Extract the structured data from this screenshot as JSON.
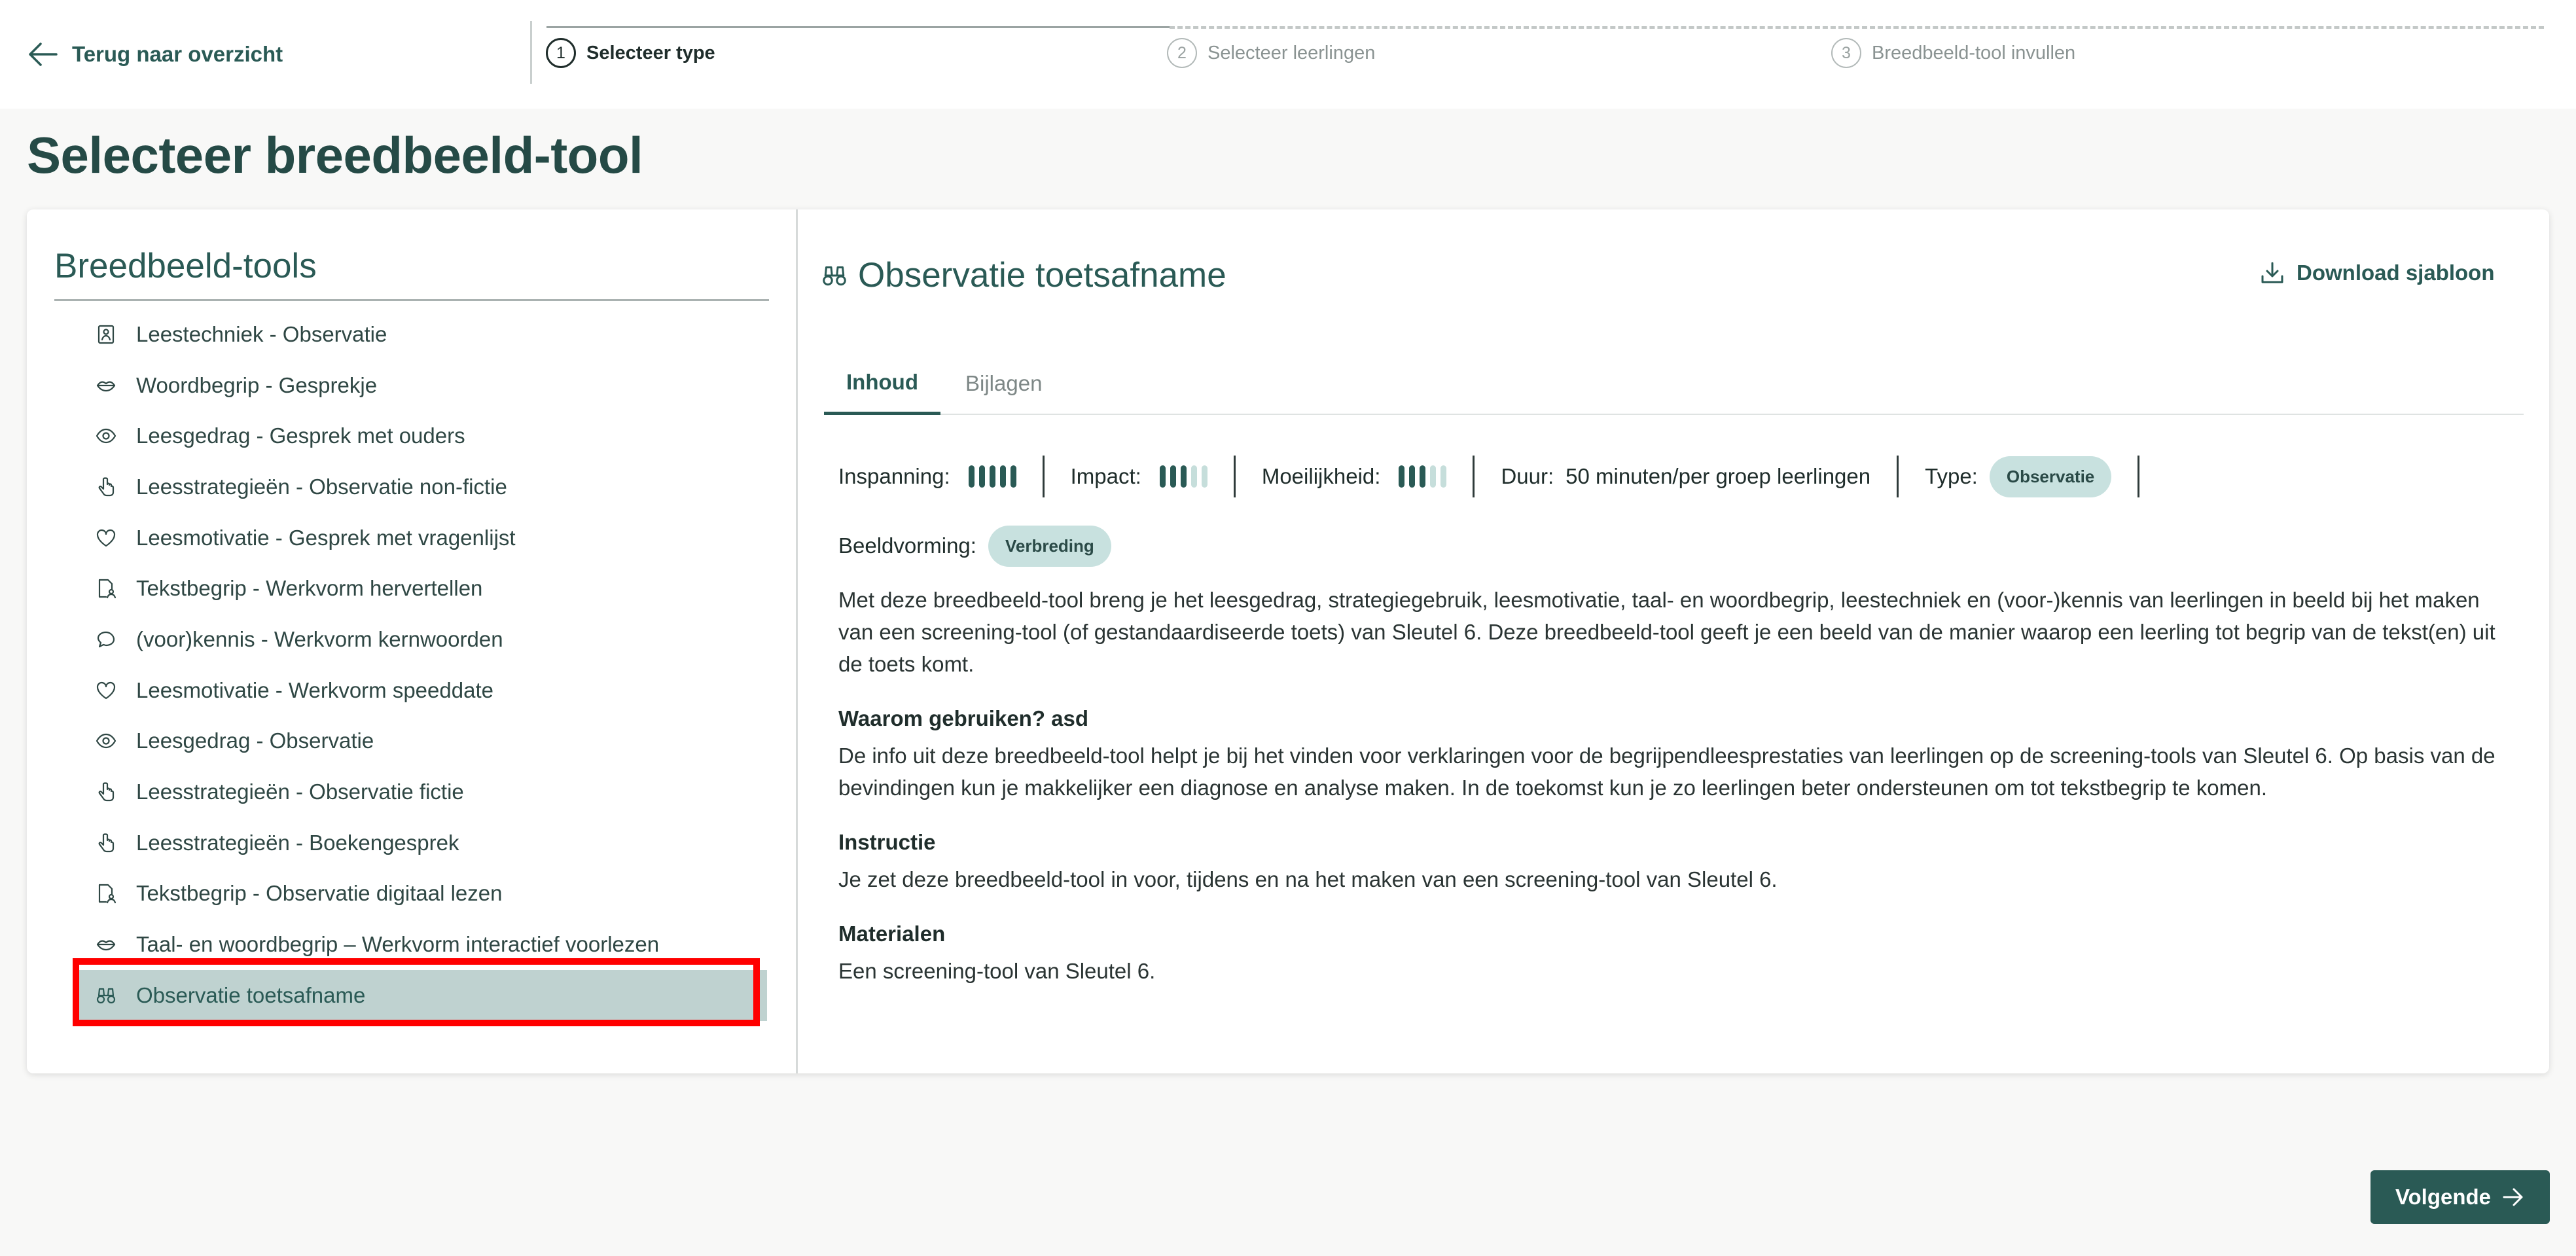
{
  "header": {
    "back_label": "Terug naar overzicht",
    "steps": [
      {
        "num": "1",
        "label": "Selecteer type"
      },
      {
        "num": "2",
        "label": "Selecteer leerlingen"
      },
      {
        "num": "3",
        "label": "Breedbeeld-tool invullen"
      }
    ]
  },
  "page_title": "Selecteer breedbeeld-tool",
  "sidebar": {
    "title": "Breedbeeld-tools",
    "items": [
      {
        "label": "Leestechniek - Observatie",
        "icon": "reader-icon"
      },
      {
        "label": "Woordbegrip - Gesprekje",
        "icon": "lips-icon"
      },
      {
        "label": "Leesgedrag - Gesprek met ouders",
        "icon": "eye-icon"
      },
      {
        "label": "Leesstrategieën - Observatie non-fictie",
        "icon": "pointer-hand-icon"
      },
      {
        "label": "Leesmotivatie - Gesprek met vragenlijst",
        "icon": "heart-icon"
      },
      {
        "label": "Tekstbegrip - Werkvorm hervertellen",
        "icon": "document-person-icon"
      },
      {
        "label": "(voor)kennis - Werkvorm kernwoorden",
        "icon": "speech-bubble-icon"
      },
      {
        "label": "Leesmotivatie - Werkvorm speeddate",
        "icon": "heart-icon"
      },
      {
        "label": "Leesgedrag - Observatie",
        "icon": "eye-icon"
      },
      {
        "label": "Leesstrategieën - Observatie fictie",
        "icon": "pointer-hand-icon"
      },
      {
        "label": "Leesstrategieën - Boekengesprek",
        "icon": "pointer-hand-icon"
      },
      {
        "label": "Tekstbegrip - Observatie digitaal lezen",
        "icon": "document-person-icon"
      },
      {
        "label": "Taal- en woordbegrip – Werkvorm interactief voorlezen",
        "icon": "lips-icon"
      },
      {
        "label": "Observatie toetsafname",
        "icon": "binoculars-icon",
        "selected": true
      }
    ]
  },
  "detail": {
    "title": "Observatie toetsafname",
    "download_label": "Download sjabloon",
    "tabs": [
      "Inhoud",
      "Bijlagen"
    ],
    "active_tab": "Inhoud",
    "meta": {
      "inspanning_label": "Inspanning:",
      "inspanning_level": 5,
      "impact_label": "Impact:",
      "impact_level": 3,
      "moeilijkheid_label": "Moeilijkheid:",
      "moeilijkheid_level": 3,
      "level_max": 5,
      "duur_label": "Duur:",
      "duur_value": "50 minuten/per groep leerlingen",
      "type_label": "Type:",
      "type_value": "Observatie",
      "beeldvorming_label": "Beeldvorming:",
      "beeldvorming_value": "Verbreding"
    },
    "intro": "Met deze breedbeeld-tool breng je het leesgedrag, strategiegebruik, leesmotivatie, taal- en woordbegrip, leestechniek en (voor-)kennis van leerlingen in beeld bij het maken van een screening-tool (of gestandaardiseerde toets) van Sleutel 6. Deze breedbeeld-tool geeft je een beeld van de manier waarop een leerling tot begrip van de tekst(en) uit de toets komt.",
    "sections": [
      {
        "heading": "Waarom gebruiken? asd",
        "text": "De info uit deze breedbeeld-tool helpt je bij het vinden voor verklaringen voor de begrijpendleesprestaties van leerlingen op de screening-tools van Sleutel 6. Op basis van de bevindingen kun je makkelijker een diagnose en analyse maken. In de toekomst kun je zo leerlingen beter ondersteunen om tot tekstbegrip te komen."
      },
      {
        "heading": "Instructie",
        "text": "Je zet deze breedbeeld-tool in voor, tijdens en na het maken van een screening-tool van Sleutel 6."
      },
      {
        "heading": "Materialen",
        "text": "Een screening-tool van Sleutel 6."
      }
    ]
  },
  "footer": {
    "next_label": "Volgende"
  },
  "colors": {
    "accent": "#2a5a55",
    "selected_bg": "#bfd2d0",
    "pill_bg": "#c8e1df",
    "highlight": "#ff0000"
  }
}
